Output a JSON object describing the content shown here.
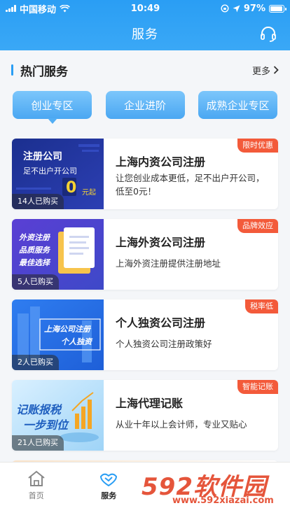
{
  "status": {
    "carrier": "中国移动",
    "time": "10:49",
    "battery": "97%",
    "battery_level": 0.97
  },
  "nav": {
    "title": "服务",
    "support_icon": "headset-icon"
  },
  "section": {
    "title": "热门服务",
    "more": "更多"
  },
  "categories": [
    {
      "label": "创业专区",
      "active": true
    },
    {
      "label": "企业进阶",
      "active": false
    },
    {
      "label": "成熟企业专区",
      "active": false
    }
  ],
  "services": [
    {
      "title": "上海内资公司注册",
      "desc": "让您创业成本更低，足不出户开公司，低至0元！",
      "tag": "限时优惠",
      "sold": "14人已购买",
      "thumb": {
        "line1": "注册公司",
        "line2": "足不出户开公司",
        "price": "0",
        "price_unit": "元起"
      }
    },
    {
      "title": "上海外资公司注册",
      "desc": "上海外资注册提供注册地址",
      "tag": "品牌效应",
      "sold": "5人已购买",
      "thumb": {
        "line1": "外资注册",
        "line2": "品质服务",
        "line3": "最佳选择"
      }
    },
    {
      "title": "个人独资公司注册",
      "desc": "个人独资公司注册政策好",
      "tag": "税率低",
      "sold": "2人已购买",
      "thumb": {
        "line1": "上海公司注册",
        "line2": "个人独资"
      }
    },
    {
      "title": "上海代理记账",
      "desc": "从业十年以上会计师，专业又贴心",
      "tag": "智能记账",
      "sold": "21人已购买",
      "thumb": {
        "line1": "记账报税",
        "line2": "一步到位"
      }
    }
  ],
  "tabs": [
    {
      "label": "首页",
      "icon": "home-icon",
      "active": false
    },
    {
      "label": "服务",
      "icon": "handshake-icon",
      "active": true
    }
  ],
  "watermark": {
    "logo": "592软件园",
    "url": "www.592xiazai.com"
  },
  "colors": {
    "primary": "#2a9ef4",
    "tag": "#f35a3a"
  }
}
